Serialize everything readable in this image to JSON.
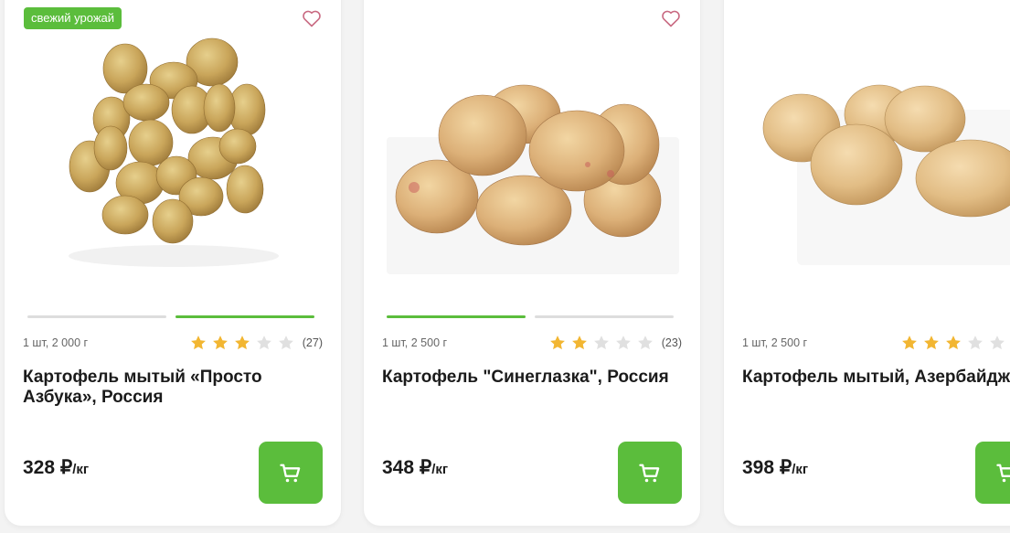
{
  "cards": [
    {
      "badge": "свежий урожай",
      "weight": "1 шт, 2 000 г",
      "stars": 3,
      "reviews": "(27)",
      "title": "Картофель мытый «Просто Азбука», Россия",
      "price": "328 ₽",
      "unit": "/кг",
      "active_slide": 2
    },
    {
      "weight": "1 шт, 2 500 г",
      "stars": 2,
      "reviews": "(23)",
      "title": "Картофель \"Синеглазка\", Россия",
      "price": "348 ₽",
      "unit": "/кг",
      "active_slide": 1
    },
    {
      "weight": "1 шт, 2 500 г",
      "stars": 3,
      "title": "Картофель мытый, Азербайджан",
      "price": "398 ₽",
      "unit": "/кг"
    }
  ],
  "colors": {
    "accent": "#5bbd3c",
    "star_on": "#f2b632",
    "star_off": "#e0e0e0"
  },
  "icons": {
    "favorite": "heart-outline-icon",
    "rating": "star-icon",
    "cart": "shopping-cart-icon"
  }
}
